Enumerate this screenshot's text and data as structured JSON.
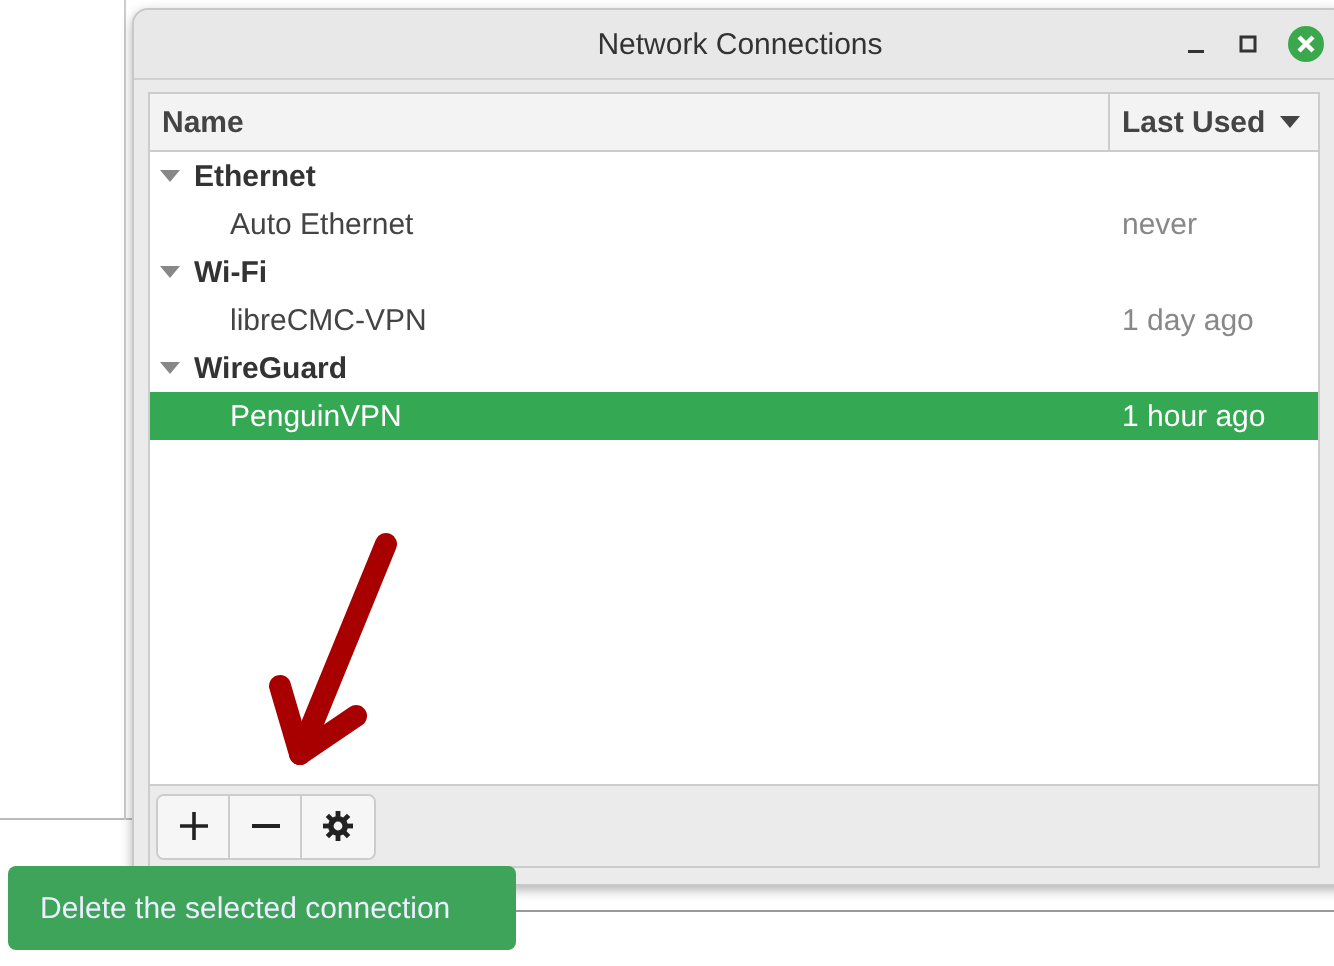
{
  "window": {
    "title": "Network Connections"
  },
  "columns": [
    {
      "label": "Name",
      "sorted": false
    },
    {
      "label": "Last Used",
      "sorted": true
    }
  ],
  "groups": [
    {
      "label": "Ethernet",
      "expanded": true,
      "children": [
        {
          "name": "Auto Ethernet",
          "last_used": "never",
          "selected": false
        }
      ]
    },
    {
      "label": "Wi-Fi",
      "expanded": true,
      "children": [
        {
          "name": "libreCMC-VPN",
          "last_used": "1 day ago",
          "selected": false
        }
      ]
    },
    {
      "label": "WireGuard",
      "expanded": true,
      "children": [
        {
          "name": "PenguinVPN",
          "last_used": "1 hour ago",
          "selected": true
        }
      ]
    }
  ],
  "toolbar": [
    {
      "kind": "add"
    },
    {
      "kind": "remove"
    },
    {
      "kind": "settings"
    }
  ],
  "tooltip": {
    "text": "Delete the selected connection"
  }
}
